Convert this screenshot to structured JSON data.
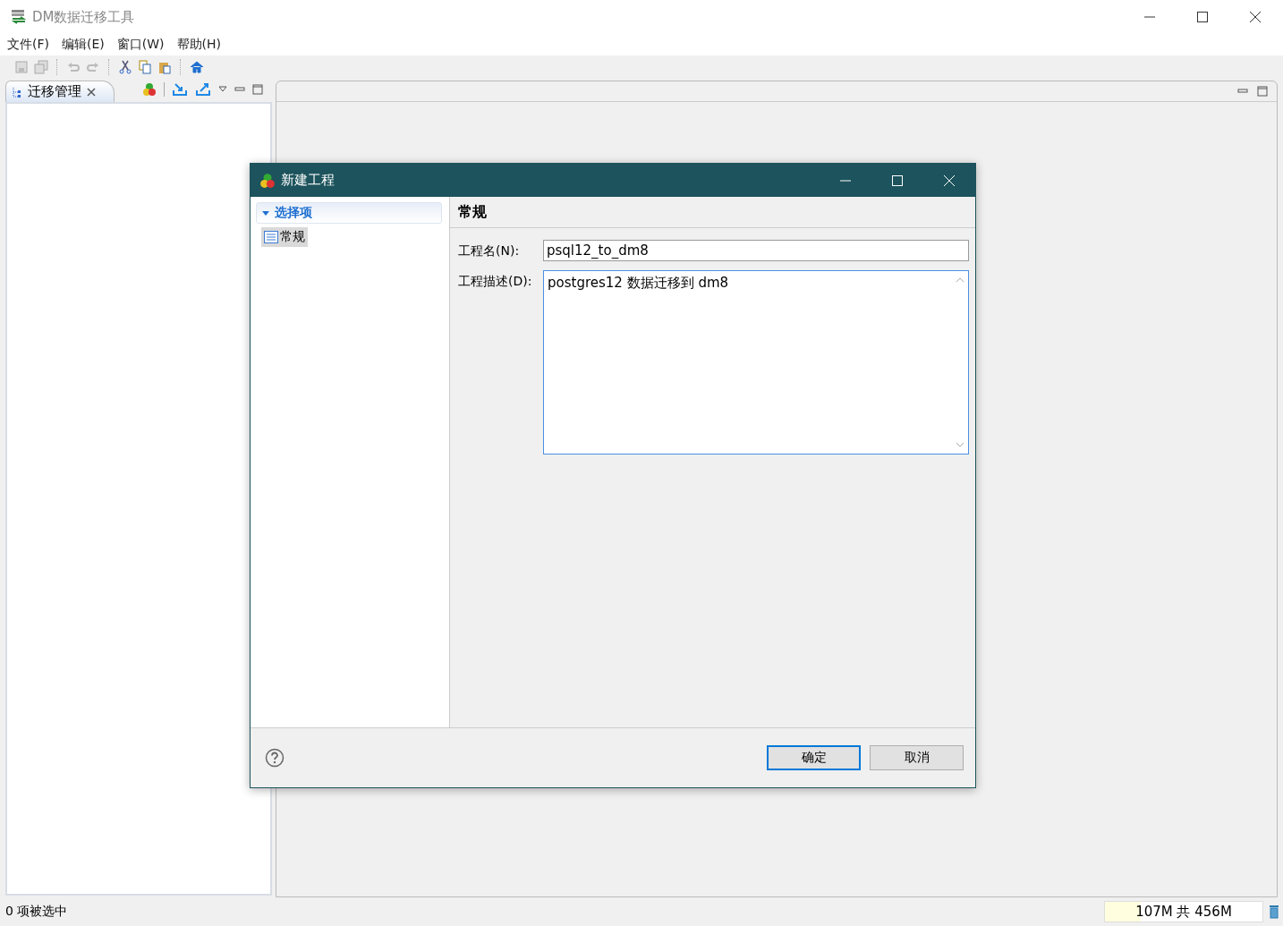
{
  "window": {
    "title": "DM数据迁移工具"
  },
  "menu": [
    "文件(F)",
    "编辑(E)",
    "窗口(W)",
    "帮助(H)"
  ],
  "left_panel": {
    "tab": {
      "label": "迁移管理",
      "selected": true
    }
  },
  "dialog": {
    "title": "新建工程",
    "tree": {
      "header": "选择项",
      "expanded": true,
      "items": [
        {
          "label": "常规",
          "selected": true
        }
      ]
    },
    "page_title": "常规",
    "fields": [
      {
        "label": "工程名(N):",
        "value": "psql12_to_dm8",
        "kind": "text"
      },
      {
        "label": "工程描述(D):",
        "value": "postgres12 数据迁移到 dm8",
        "kind": "textarea"
      }
    ],
    "buttons": [
      {
        "label": "确定",
        "default": true
      },
      {
        "label": "取消",
        "default": false
      }
    ]
  },
  "status_bar": {
    "text": "0 项被选中",
    "memory": {
      "reading": "107M 共 456M",
      "level": 0.23
    }
  }
}
